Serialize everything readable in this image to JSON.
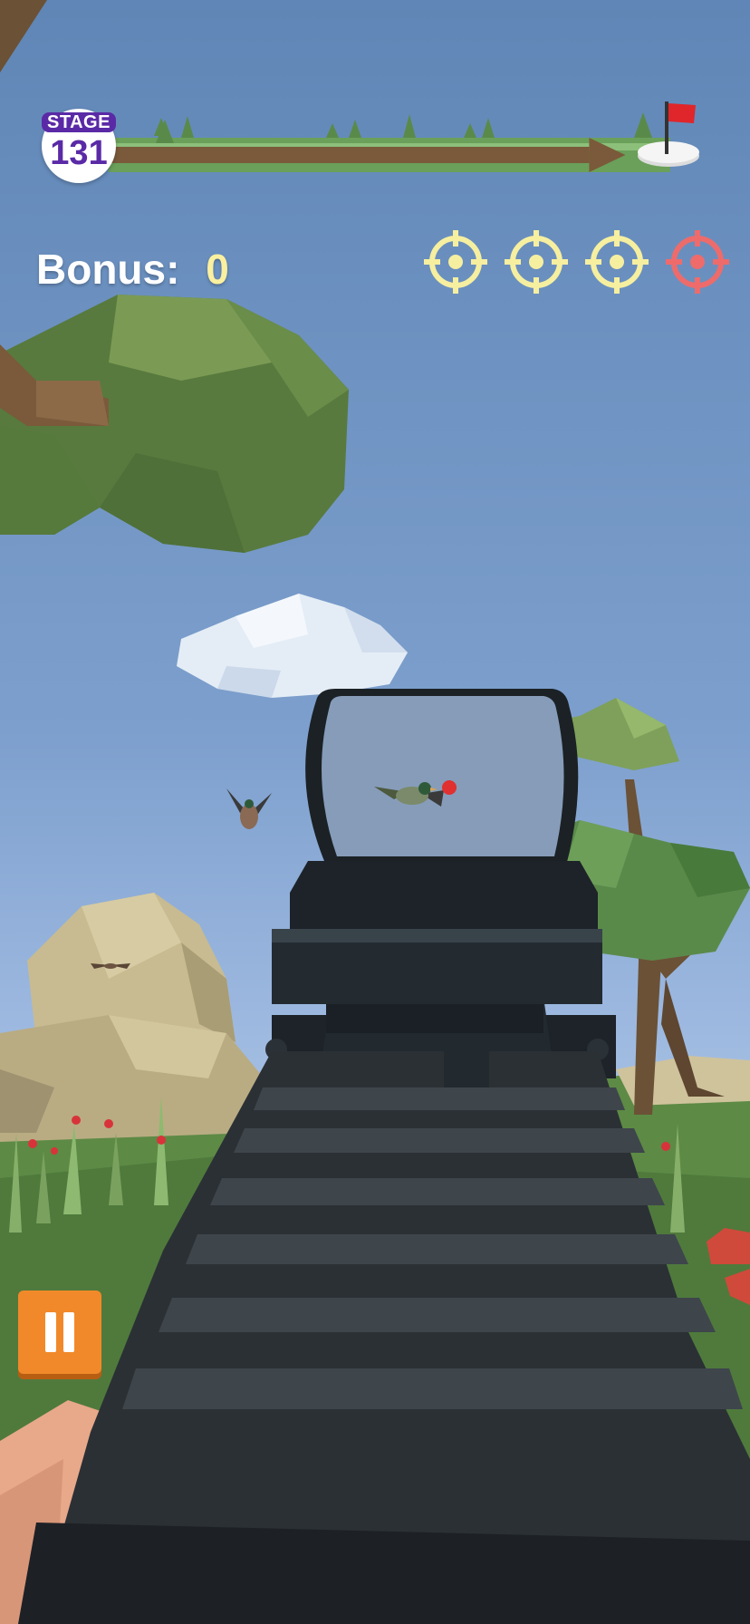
{
  "hud": {
    "stage_label": "STAGE",
    "stage_number": "131",
    "progress": 0.92,
    "bonus_label": "Bonus:",
    "bonus_value": "0",
    "targets": [
      {
        "state": "available",
        "color": "#f6efa0"
      },
      {
        "state": "available",
        "color": "#f6efa0"
      },
      {
        "state": "available",
        "color": "#f6efa0"
      },
      {
        "state": "active",
        "color": "#ee6b6b"
      }
    ],
    "pause_icon": "pause-icon"
  },
  "colors": {
    "stage_purple": "#5a2aa6",
    "pause_orange": "#f1892a",
    "progress_track_green": "#6aa05a",
    "progress_arrow_brown": "#7a5a3a",
    "finish_flag_red": "#e0262a",
    "reticle_dot_red": "#e03030"
  },
  "scene": {
    "flying_ducks": 3,
    "weapon": "rifle-with-red-dot-sight"
  }
}
